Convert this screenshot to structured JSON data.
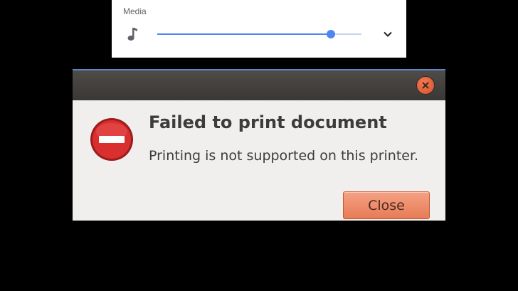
{
  "media_panel": {
    "label": "Media",
    "icon": "music-note-icon",
    "expand_icon": "chevron-down-icon",
    "volume_level": 0.85,
    "accent_color": "#4c86f0"
  },
  "dialog": {
    "close_icon": "window-close-icon",
    "error_icon": "error-icon",
    "title": "Failed to print document",
    "message": "Printing is not supported on this printer.",
    "close_button_label": "Close",
    "accent_color": "#e77c57"
  }
}
